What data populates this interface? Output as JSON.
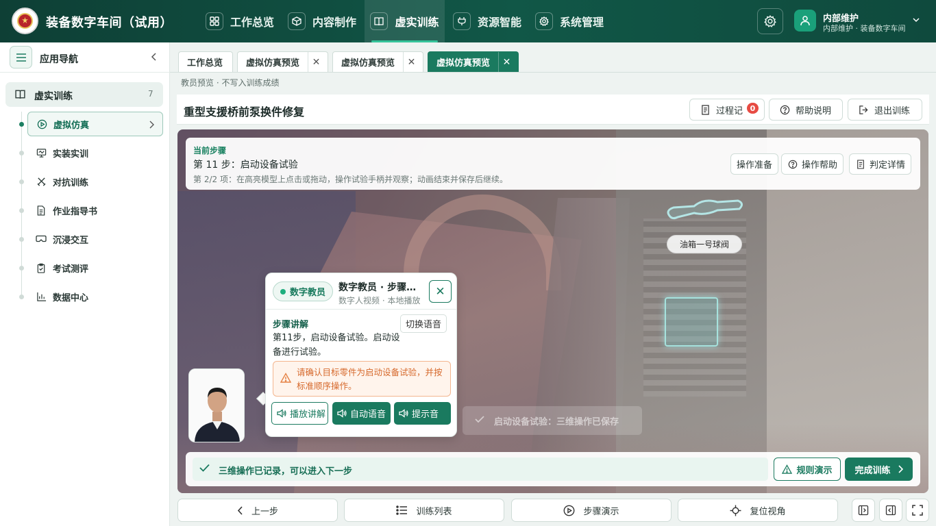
{
  "app": {
    "title": "装备数字车间（试用）"
  },
  "topnav": [
    {
      "label": "工作总览",
      "icon": "grid-icon"
    },
    {
      "label": "内容制作",
      "icon": "cube-icon"
    },
    {
      "label": "虚实训练",
      "icon": "book-icon",
      "active": true
    },
    {
      "label": "资源智能",
      "icon": "plug-icon"
    },
    {
      "label": "系统管理",
      "icon": "gear-icon"
    }
  ],
  "user": {
    "name": "内部维护",
    "subtitle": "内部维护 · 装备数字车间"
  },
  "sidebar": {
    "title": "应用导航",
    "group": {
      "label": "虚实训练",
      "count": "7"
    },
    "items": [
      {
        "label": "虚拟仿真",
        "active": true
      },
      {
        "label": "实装实训"
      },
      {
        "label": "对抗训练"
      },
      {
        "label": "作业指导书"
      },
      {
        "label": "沉浸交互"
      },
      {
        "label": "考试测评"
      },
      {
        "label": "数据中心"
      }
    ]
  },
  "tabs": [
    {
      "label": "工作总览"
    },
    {
      "label": "虚拟仿真预览"
    },
    {
      "label": "虚拟仿真预览"
    },
    {
      "label": "虚拟仿真预览",
      "active": true
    }
  ],
  "subnote": "教员预览 · 不写入训练成绩",
  "header": {
    "title": "重型支援桥前泵换件修复",
    "buttons": {
      "record": "过程记",
      "record_badge": "0",
      "help": "帮助说明",
      "exit": "退出训练"
    }
  },
  "step": {
    "kicker": "当前步骤",
    "title": "第 11 步：启动设备试验",
    "desc": "第 2/2 项：在高亮模型上点击或拖动，操作试验手柄并观察；动画结束并保存后继续。",
    "buttons": {
      "prep": "操作准备",
      "help": "操作帮助",
      "judge": "判定详情"
    }
  },
  "scene": {
    "valve_label": "油箱一号球阀",
    "ghost_toast": "启动设备试验：三维操作已保存"
  },
  "teacher": {
    "pill": "数字教员",
    "title": "数字教员 · 步骤讲解",
    "subtitle": "数字人视频 · 本地播放",
    "section_label": "步骤讲解",
    "switch_voice": "切换语音",
    "text": "第11步，启动设备试验。启动设备进行试验。",
    "warning": "请确认目标零件为启动设备试验，并按标准顺序操作。",
    "buttons": {
      "play": "播放讲解",
      "auto": "自动语音",
      "tone": "提示音"
    }
  },
  "bottom": {
    "recorded": "三维操作已记录，可以进入下一步",
    "rule": "规则演示",
    "finish": "完成训练"
  },
  "footer": {
    "prev": "上一步",
    "list": "训练列表",
    "demo": "步骤演示",
    "reset": "复位视角"
  },
  "colors": {
    "brand": "#115747",
    "accent": "#1a7a5f",
    "warning": "#d6692c",
    "badge": "#e74b43"
  }
}
